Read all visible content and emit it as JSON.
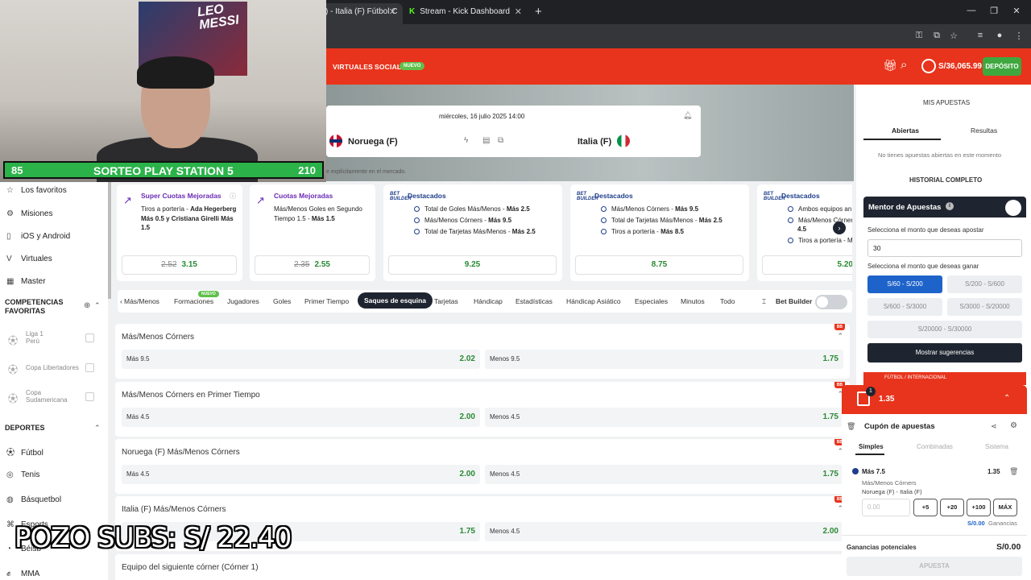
{
  "browser": {
    "tabs": [
      {
        "label": ") - Italia (F) Fútbol C"
      },
      {
        "label": "Stream - Kick Dashboard"
      }
    ],
    "new_tab": "+",
    "window_controls": [
      "—",
      "❐",
      "✕"
    ]
  },
  "header": {
    "nav": [
      "VIRTUALES",
      "SOCIAL"
    ],
    "nuevo_badge": "NUEVO",
    "balance": "S/36,065.99",
    "deposit_label": "DEPÓSITO",
    "colors": {
      "brand": "#e8341c",
      "deposit": "#3ea83f"
    }
  },
  "stream": {
    "poster_text": "LEO MESSI",
    "sorteo_left": "85",
    "sorteo_title": "SORTEO PLAY STATION 5",
    "sorteo_right": "210",
    "pozo": "POZO SUBS: S/ 22.40"
  },
  "match": {
    "datetime": "miércoles, 16 julio 2025 14:00",
    "home": "Noruega (F)",
    "away": "Italia (F)",
    "note": "e explícitamente en el mercado."
  },
  "sidebar": {
    "items": [
      {
        "label": "Los favoritos",
        "icon": "star-icon"
      },
      {
        "label": "Misiones",
        "icon": "gear-icon"
      },
      {
        "label": "iOS y Android",
        "icon": "phone-icon"
      },
      {
        "label": "Virtuales",
        "icon": "v-icon"
      },
      {
        "label": "Master",
        "icon": "master-icon"
      }
    ],
    "competencias_title": "COMPETENCIAS FAVORITAS",
    "favorites": [
      {
        "line1": "Liga 1",
        "line2": "Perú"
      },
      {
        "line1": "Copa Libertadores",
        "line2": ""
      },
      {
        "line1": "Copa",
        "line2": "Sudamericana"
      }
    ],
    "deportes_title": "DEPORTES",
    "sports": [
      "Fútbol",
      "Tenis",
      "Básquetbol",
      "Esports",
      "Béisb",
      "MMA"
    ]
  },
  "cards": [
    {
      "title": "Super Cuotas Mejoradas",
      "desc_parts": [
        "Tiros a portería - ",
        "Ada Hegerberg Más 0.5 y Cristiana Girelli Más 1.5"
      ],
      "old": "2.52",
      "odd": "3.15"
    },
    {
      "title": "Cuotas Mejoradas",
      "desc_parts": [
        "Más/Menos Goles en Segundo Tiempo 1.5 - ",
        "Más 1.5"
      ],
      "old": "2.35",
      "odd": "2.55"
    },
    {
      "title": "Destacados",
      "lines": [
        [
          "Total de Goles Más/Menos - ",
          "Más 2.5"
        ],
        [
          "Más/Menos Córners - ",
          "Más 9.5"
        ],
        [
          "Total de Tarjetas Más/Menos - ",
          "Más 2.5"
        ]
      ],
      "odd": "9.25"
    },
    {
      "title": "Destacados",
      "lines": [
        [
          "Más/Menos Córners - ",
          "Más 9.5"
        ],
        [
          "Total de Tarjetas Más/Menos - ",
          "Más 2.5"
        ],
        [
          "Tiros a portería - ",
          "Más 8.5"
        ]
      ],
      "odd": "8.75"
    },
    {
      "title": "Destacados",
      "lines": [
        [
          "Ambos equipos an",
          ""
        ],
        [
          "Más/Menos Córner",
          ""
        ],
        [
          "4.5",
          ""
        ],
        [
          "Tiros a portería - M",
          ""
        ]
      ],
      "odd": "5.20"
    }
  ],
  "bet_builder_logo": "BET BUILDER",
  "market_tabs": [
    "Más/Menos",
    "Formaciones",
    "Jugadores",
    "Goles",
    "Primer Tiempo",
    "Saques de esquina",
    "Tarjetas",
    "Hándicap",
    "Estadísticas",
    "Hándicap Asiático",
    "Especiales",
    "Minutos",
    "Todo"
  ],
  "market_tabs_nuevo": "NUEVO",
  "bet_builder_label": "Bet Builder",
  "markets": [
    {
      "title": "Más/Menos Córners",
      "left_label": "Más 9.5",
      "left_odd": "2.02",
      "right_label": "Menos 9.5",
      "right_odd": "1.75"
    },
    {
      "title": "Más/Menos Córners en Primer Tiempo",
      "left_label": "Más 4.5",
      "left_odd": "2.00",
      "right_label": "Menos 4.5",
      "right_odd": "1.75"
    },
    {
      "title": "Noruega (F) Más/Menos Córners",
      "left_label": "Más 4.5",
      "left_odd": "2.00",
      "right_label": "Menos 4.5",
      "right_odd": "1.75"
    },
    {
      "title": "Italia (F) Más/Menos Córners",
      "left_label": "",
      "left_odd": "1.75",
      "right_label": "Menos 4.5",
      "right_odd": "2.00"
    },
    {
      "title": "Equipo del siguiente córner (Córner 1)",
      "left_label": "",
      "left_odd": "",
      "right_label": "",
      "right_odd": ""
    }
  ],
  "bb_badge": "BB",
  "right": {
    "mis_apuestas": "MIS APUESTAS",
    "tab_abiertas": "Abiertas",
    "tab_resultas": "Resultas",
    "no_apuestas": "No tienes apuestas abiertas en este momento",
    "historial": "HISTORIAL COMPLETO",
    "mentor_title": "Mentor de Apuestas",
    "mentor_info": "i",
    "select_monto": "Selecciona el monto que deseas apostar",
    "monto_value": "30",
    "select_ganar": "Selecciona el monto que deseas ganar",
    "ranges": [
      "S/60 - S/200",
      "S/200 - S/600",
      "S/600 - S/3000",
      "S/3000 - S/20000",
      "S/20000 - S/30000"
    ],
    "sugerencias": "Mostrar sugerencias"
  },
  "slip": {
    "crumb": "FÚTBOL  /  INTERNACIONAL",
    "count": "1",
    "odd": "1.35",
    "title": "Cupón de apuestas",
    "tabs": [
      "Simples",
      "Combinadas",
      "Sistema"
    ],
    "selection": "Más 7.5",
    "selection_odd": "1.35",
    "market": "Más/Menos Córners",
    "match": "Noruega (F) - Italia (F)",
    "stake_placeholder": "0.00",
    "quick": [
      "+5",
      "+20",
      "+100",
      "MÁX"
    ],
    "ganancias_value": "S/0.00",
    "ganancias_label": "Ganancias",
    "potential_label": "Ganancias potenciales",
    "potential_value": "S/0.00",
    "apuesta": "APUESTA"
  }
}
